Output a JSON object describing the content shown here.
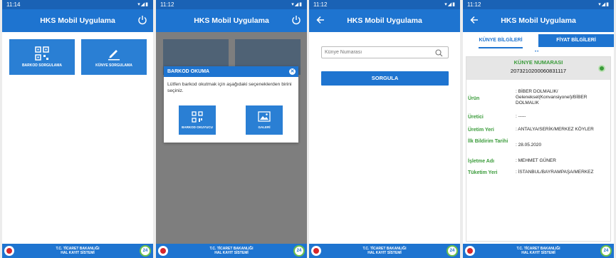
{
  "app_title": "HKS Mobil Uygulama",
  "footer": {
    "line1": "T.C. TİCARET BAKANLIĞI",
    "line2": "HAL KAYIT SİSTEMİ",
    "badge": "24"
  },
  "screens": [
    {
      "time": "11:14",
      "tiles": [
        {
          "label": "BARKOD SORGULAMA",
          "icon": "qr-code-icon"
        },
        {
          "label": "KÜNYE SORGULAMA",
          "icon": "pencil-icon"
        }
      ]
    },
    {
      "time": "11:12",
      "dialog": {
        "title": "BARKOD OKUMA",
        "message": "Lütfen barkod okutmak için aşağıdaki seçeneklerden birini seçiniz.",
        "btn_scanner": "BARKOD OKUYUCU",
        "btn_gallery": "GALERİ"
      }
    },
    {
      "time": "11:12",
      "search_placeholder": "Künye Numarası",
      "search_button": "SORGULA"
    },
    {
      "time": "11:12",
      "tabs": [
        "KÜNYE BİLGİLERİ",
        "FİYAT BİLGİLERİ"
      ],
      "card_title": "KÜNYE NUMARASI",
      "card_number": "2073210200060831117",
      "fields": [
        {
          "key": "Ürün",
          "value": ": BİBER DOLMALIK/ Geleneksel(Konvansiyonel)/BİBER DOLMALIK"
        },
        {
          "key": "Üretici",
          "value": ": -----"
        },
        {
          "key": "Üretim Yeri",
          "value": ": ANTALYA/SERİK/MERKEZ KÖYLER"
        },
        {
          "key": "İlk Bildirim Tarihi",
          "value": ": 28.05.2020"
        },
        {
          "key": "İşletme Adı",
          "value": ": MEHMET GÜNER"
        },
        {
          "key": "Tüketim Yeri",
          "value": ": İSTANBUL/BAYRAMPAŞA/MERKEZ"
        }
      ]
    }
  ],
  "colors": {
    "primary": "#1e74d0",
    "status_bar": "#1a62b5",
    "accent_green": "#3a9b3a"
  }
}
